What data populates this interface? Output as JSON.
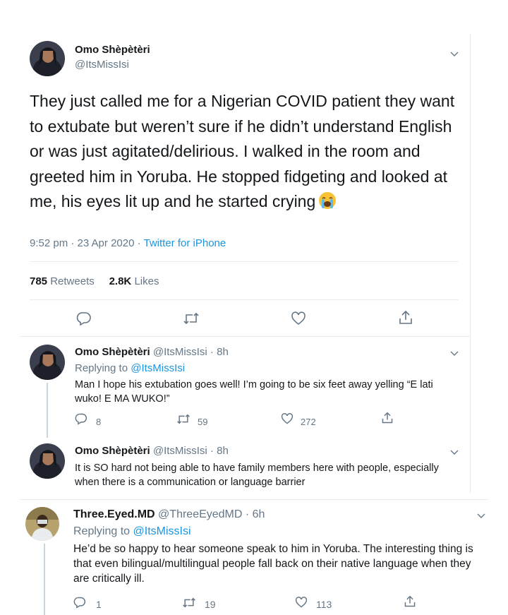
{
  "main_tweet": {
    "author_name": "Omo Shèpètèri",
    "author_handle": "@ItsMissIsi",
    "text": "They just called me for a Nigerian COVID patient they want to extubate but weren’t sure if he didn’t understand English or was just agitated/delirious. I walked in the room and greeted him in Yoruba. He stopped fidgeting and looked at me, his eyes lit up and he started crying",
    "timestamp": "9:52 pm · 23 Apr 2020 · ",
    "source": "Twitter for iPhone",
    "retweets_count": "785",
    "retweets_label": "Retweets",
    "likes_count": "2.8K",
    "likes_label": "Likes",
    "emoji": "crying-face"
  },
  "replies": [
    {
      "author_name": "Omo Shèpètèri",
      "author_handle": "@ItsMissIsi",
      "time": " · 8h",
      "replying_prefix": "Replying to ",
      "replying_to": "@ItsMissIsi",
      "text": "Man I hope his extubation goes well! I’m going to be six feet away yelling “E lati wuko! E MA WUKO!”",
      "reply_count": "8",
      "retweet_count": "59",
      "like_count": "272"
    },
    {
      "author_name": "Omo Shèpètèri",
      "author_handle": "@ItsMissIsi",
      "time": " · 8h",
      "text": "It is SO hard not being able to have family members here with people, especially when there is a communication or language barrier"
    },
    {
      "author_name": "Three.Eyed.MD",
      "author_handle": "@ThreeEyedMD",
      "time": " · 6h",
      "replying_prefix": "Replying to ",
      "replying_to": "@ItsMissIsi",
      "text": "He’d be so happy to hear someone speak to him in Yoruba. The interesting thing is that even bilingual/multilingual people fall back on their native language when they are critically ill.",
      "reply_count": "1",
      "retweet_count": "19",
      "like_count": "113"
    }
  ],
  "colors": {
    "text": "#14171a",
    "secondary": "#657786",
    "link": "#1b95e0",
    "divider": "#e6ecf0"
  }
}
